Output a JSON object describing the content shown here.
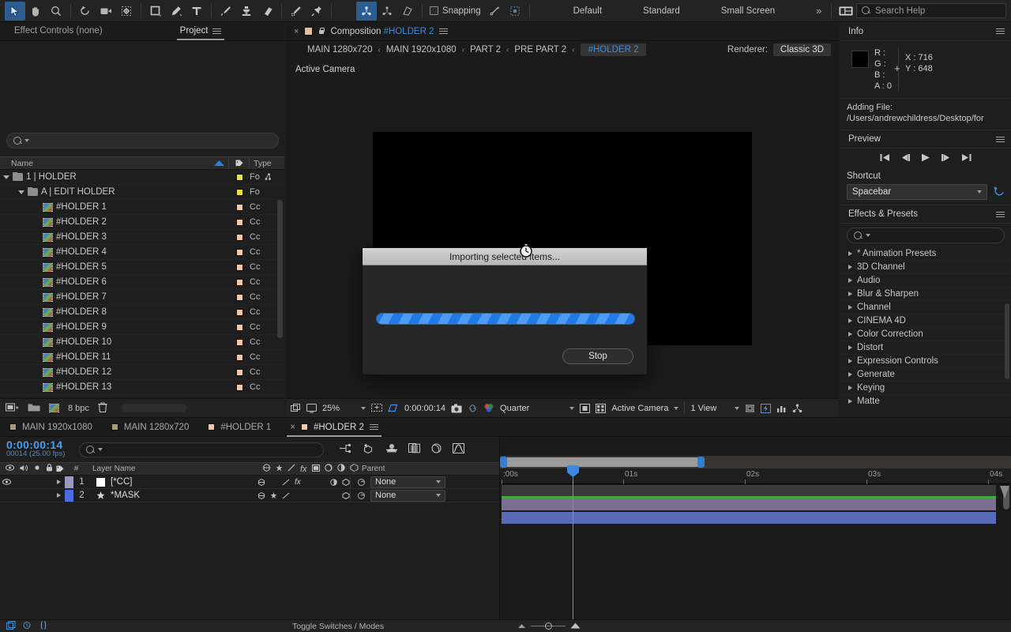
{
  "toolbar": {
    "tools": [
      {
        "name": "selection-tool",
        "glyph": "arrow",
        "selected": true
      },
      {
        "name": "hand-tool",
        "glyph": "hand",
        "selected": false
      },
      {
        "name": "zoom-tool",
        "glyph": "magnifier",
        "selected": false
      },
      {
        "name": "rotation-tool",
        "glyph": "rotate",
        "selected": false
      },
      {
        "name": "camera-tool",
        "glyph": "camera",
        "selected": false
      },
      {
        "name": "pan-behind-tool",
        "glyph": "anchor",
        "selected": false
      },
      {
        "name": "shape-tool",
        "glyph": "square",
        "selected": false
      },
      {
        "name": "pen-tool",
        "glyph": "pen",
        "selected": false
      },
      {
        "name": "type-tool",
        "glyph": "type",
        "selected": false
      },
      {
        "name": "brush-tool",
        "glyph": "brush",
        "selected": false
      },
      {
        "name": "clone-stamp-tool",
        "glyph": "stamp",
        "selected": false
      },
      {
        "name": "eraser-tool",
        "glyph": "eraser",
        "selected": false
      },
      {
        "name": "roto-brush-tool",
        "glyph": "roto",
        "selected": false
      },
      {
        "name": "puppet-pin-tool",
        "glyph": "pin",
        "selected": false
      }
    ],
    "axis_tools": [
      {
        "name": "local-axis-mode",
        "selected": true
      },
      {
        "name": "world-axis-mode",
        "selected": false
      },
      {
        "name": "view-axis-mode",
        "selected": false
      }
    ],
    "snapping_label": "Snapping",
    "snapping_checked": false,
    "workspaces": [
      "Default",
      "Standard",
      "Small Screen"
    ],
    "overflow_label": "»",
    "search_placeholder": "Search Help"
  },
  "project_panel": {
    "tabs": [
      {
        "label": "Effect Controls (none)",
        "active": false
      },
      {
        "label": "Project",
        "active": true
      }
    ],
    "search_value": "",
    "columns": {
      "name": "Name",
      "label": "",
      "type": "Type"
    },
    "items": [
      {
        "name": "1 | HOLDER",
        "type": "Fo",
        "indent": 0,
        "kind": "folder",
        "expanded": true,
        "color": "#e8e04a"
      },
      {
        "name": "A | EDIT HOLDER",
        "type": "Fo",
        "indent": 1,
        "kind": "folder",
        "expanded": true,
        "color": "#e8e04a"
      },
      {
        "name": "#HOLDER 1",
        "type": "Cc",
        "indent": 2,
        "kind": "comp",
        "color": "#f4c7a8"
      },
      {
        "name": "#HOLDER 2",
        "type": "Cc",
        "indent": 2,
        "kind": "comp",
        "color": "#f4c7a8"
      },
      {
        "name": "#HOLDER 3",
        "type": "Cc",
        "indent": 2,
        "kind": "comp",
        "color": "#f4c7a8"
      },
      {
        "name": "#HOLDER 4",
        "type": "Cc",
        "indent": 2,
        "kind": "comp",
        "color": "#f4c7a8"
      },
      {
        "name": "#HOLDER 5",
        "type": "Cc",
        "indent": 2,
        "kind": "comp",
        "color": "#f4c7a8"
      },
      {
        "name": "#HOLDER 6",
        "type": "Cc",
        "indent": 2,
        "kind": "comp",
        "color": "#f4c7a8"
      },
      {
        "name": "#HOLDER 7",
        "type": "Cc",
        "indent": 2,
        "kind": "comp",
        "color": "#f4c7a8"
      },
      {
        "name": "#HOLDER 8",
        "type": "Cc",
        "indent": 2,
        "kind": "comp",
        "color": "#f4c7a8"
      },
      {
        "name": "#HOLDER 9",
        "type": "Cc",
        "indent": 2,
        "kind": "comp",
        "color": "#f4c7a8"
      },
      {
        "name": "#HOLDER 10",
        "type": "Cc",
        "indent": 2,
        "kind": "comp",
        "color": "#f4c7a8"
      },
      {
        "name": "#HOLDER 11",
        "type": "Cc",
        "indent": 2,
        "kind": "comp",
        "color": "#f4c7a8"
      },
      {
        "name": "#HOLDER 12",
        "type": "Cc",
        "indent": 2,
        "kind": "comp",
        "color": "#f4c7a8"
      },
      {
        "name": "#HOLDER 13",
        "type": "Cc",
        "indent": 2,
        "kind": "comp",
        "color": "#f4c7a8"
      }
    ],
    "footer": {
      "bit_depth": "8 bpc"
    }
  },
  "comp_panel": {
    "tab_title_prefix": "Composition",
    "tab_title_name": "#HOLDER 2",
    "breadcrumb": [
      {
        "label": "MAIN 1280x720",
        "current": false
      },
      {
        "label": "MAIN 1920x1080",
        "current": false
      },
      {
        "label": "PART 2",
        "current": false
      },
      {
        "label": "PRE PART 2",
        "current": false
      },
      {
        "label": "#HOLDER 2",
        "current": true
      }
    ],
    "renderer_label": "Renderer:",
    "renderer_value": "Classic 3D",
    "view_label": "Active Camera",
    "footer": {
      "zoom": "25%",
      "timecode": "0:00:00:14",
      "resolution": "Quarter",
      "camera": "Active Camera",
      "views": "1 View"
    }
  },
  "info_panel": {
    "title": "Info",
    "r_label": "R :",
    "r_value": "",
    "g_label": "G :",
    "g_value": "",
    "b_label": "B :",
    "b_value": "",
    "a_label": "A :",
    "a_value": "0",
    "x_label": "X :",
    "x_value": "716",
    "y_label": "Y :",
    "y_value": "648",
    "status_title": "Adding File:",
    "status_path": "/Users/andrewchildress/Desktop/for"
  },
  "preview_panel": {
    "title": "Preview",
    "shortcut_label": "Shortcut",
    "shortcut_value": "Spacebar"
  },
  "effects_panel": {
    "title": "Effects & Presets",
    "search_value": "",
    "categories": [
      "* Animation Presets",
      "3D Channel",
      "Audio",
      "Blur & Sharpen",
      "Channel",
      "CINEMA 4D",
      "Color Correction",
      "Distort",
      "Expression Controls",
      "Generate",
      "Keying",
      "Matte"
    ]
  },
  "timeline": {
    "tabs": [
      {
        "label": "MAIN 1920x1080",
        "active": false,
        "color": "#b09878"
      },
      {
        "label": "MAIN 1280x720",
        "active": false,
        "color": "#b09878"
      },
      {
        "label": "#HOLDER 1",
        "active": false,
        "color": "#f4c7a8"
      },
      {
        "label": "#HOLDER 2",
        "active": true,
        "color": "#f4c7a8"
      }
    ],
    "timecode": "0:00:00:14",
    "timecode_sub": "00014 (25.00 fps)",
    "search_value": "",
    "columns": {
      "num": "#",
      "layer_name": "Layer Name",
      "parent": "Parent"
    },
    "layers": [
      {
        "num": "1",
        "name": "[*CC]",
        "parent": "None",
        "color": "#9a9ac4",
        "visible": true,
        "icon": "solid",
        "switches": [
          "collapse",
          "motion-blur",
          "effects",
          "adjustment",
          "3d"
        ]
      },
      {
        "num": "2",
        "name": "*MASK",
        "parent": "None",
        "color": "#4a6de0",
        "visible": false,
        "icon": "star",
        "switches": [
          "collapse",
          "shy",
          "motion-blur",
          "3d"
        ]
      }
    ],
    "ruler_ticks": [
      ":00s",
      "01s",
      "02s",
      "03s",
      "04s"
    ],
    "toggle_label": "Toggle Switches / Modes"
  },
  "modal": {
    "title": "Importing selected items...",
    "stop_label": "Stop",
    "progress_color": "#1f7ae6"
  }
}
